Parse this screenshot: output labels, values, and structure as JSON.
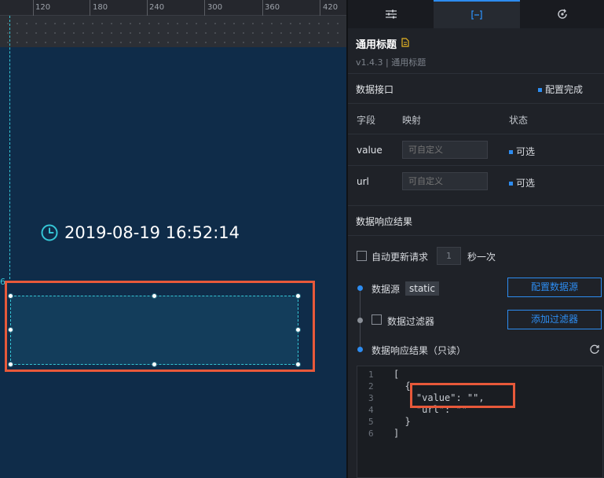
{
  "ruler": {
    "ticks": [
      "120",
      "180",
      "240",
      "300",
      "360",
      "420"
    ]
  },
  "canvas": {
    "guide_label": "6",
    "clock_text": "2019-08-19 16:52:14"
  },
  "tabs": [
    {
      "name": "style-tab",
      "icon": "sliders-icon"
    },
    {
      "name": "data-tab",
      "icon": "data-bracket-icon"
    },
    {
      "name": "interaction-tab",
      "icon": "refresh-settings-icon"
    }
  ],
  "component": {
    "title": "通用标题",
    "version": "v1.4.3 | 通用标题"
  },
  "data_interface": {
    "title": "数据接口",
    "status": "配置完成",
    "headers": {
      "field": "字段",
      "mapping": "映射",
      "state": "状态"
    },
    "rows": [
      {
        "field": "value",
        "placeholder": "可自定义",
        "state": "可选"
      },
      {
        "field": "url",
        "placeholder": "可自定义",
        "state": "可选"
      }
    ]
  },
  "response": {
    "title": "数据响应结果",
    "auto_update_label": "自动更新请求",
    "interval_value": "1",
    "interval_unit": "秒一次",
    "source_label": "数据源",
    "source_badge": "static",
    "config_source_button": "配置数据源",
    "filter_label": "数据过滤器",
    "add_filter_button": "添加过滤器",
    "result_label": "数据响应结果（只读）"
  },
  "code": {
    "line_numbers": [
      "1",
      "2",
      "3",
      "4",
      "5",
      "6"
    ],
    "lines": [
      "[",
      "  {",
      "    \"value\": \"\",",
      "    \"url\": \"\"",
      "  }",
      "]"
    ]
  },
  "colors": {
    "accent": "#2d8cf0",
    "highlight": "#e8593a",
    "guide": "#35c6d6",
    "canvas_bg": "#0f2c49"
  }
}
